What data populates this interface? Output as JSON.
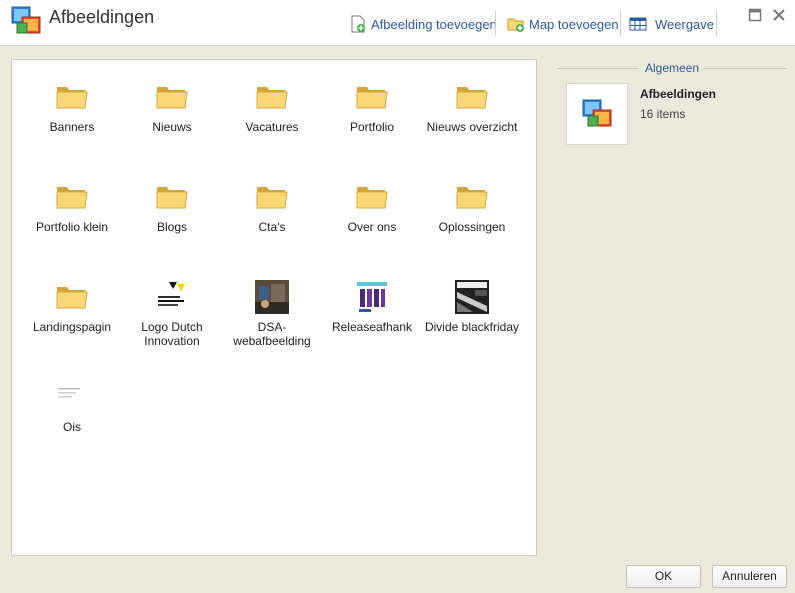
{
  "window": {
    "title": "Afbeeldingen",
    "toolbar": {
      "add_image_label": "Afbeelding toevoegen",
      "add_folder_label": "Map toevoegen",
      "view_label": "Weergave"
    }
  },
  "items": [
    {
      "label": "Banners",
      "kind": "folder"
    },
    {
      "label": "Nieuws",
      "kind": "folder"
    },
    {
      "label": "Vacatures",
      "kind": "folder"
    },
    {
      "label": "Portfolio",
      "kind": "folder"
    },
    {
      "label": "Nieuws overzicht",
      "kind": "folder"
    },
    {
      "label": "Portfolio klein",
      "kind": "folder"
    },
    {
      "label": "Blogs",
      "kind": "folder"
    },
    {
      "label": "Cta's",
      "kind": "folder"
    },
    {
      "label": "Over ons",
      "kind": "folder"
    },
    {
      "label": "Oplossingen",
      "kind": "folder"
    },
    {
      "label": "Landingspagin",
      "kind": "folder"
    },
    {
      "label": "Logo Dutch Innovation",
      "kind": "image"
    },
    {
      "label": "DSA-webafbeelding",
      "kind": "image"
    },
    {
      "label": "Releaseafhank",
      "kind": "image"
    },
    {
      "label": "Divide blackfriday",
      "kind": "image"
    },
    {
      "label": "Ois",
      "kind": "image"
    }
  ],
  "info": {
    "section_label": "Algemeen",
    "name": "Afbeeldingen",
    "count": "16 items"
  },
  "footer": {
    "ok_label": "OK",
    "cancel_label": "Annuleren"
  },
  "colors": {
    "link": "#2d5a9b",
    "folder_fill": "#fcd874",
    "folder_stroke": "#d4a53a"
  }
}
